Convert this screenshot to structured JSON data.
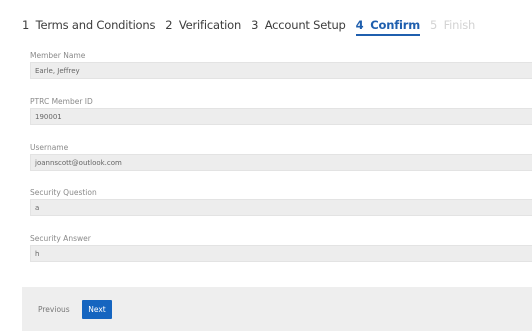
{
  "wizard": {
    "steps": [
      {
        "num": "1",
        "label": "Terms and Conditions",
        "state": "done"
      },
      {
        "num": "2",
        "label": "Verification",
        "state": "done"
      },
      {
        "num": "3",
        "label": "Account Setup",
        "state": "done"
      },
      {
        "num": "4",
        "label": "Confirm",
        "state": "active"
      },
      {
        "num": "5",
        "label": "Finish",
        "state": "disabled"
      }
    ]
  },
  "form": {
    "member_name": {
      "label": "Member Name",
      "value": "Earle, Jeffrey"
    },
    "member_id": {
      "label": "PTRC Member ID",
      "value": "190001"
    },
    "username": {
      "label": "Username",
      "value": "joannscott@outlook.com"
    },
    "security_question": {
      "label": "Security Question",
      "value": "a"
    },
    "security_answer": {
      "label": "Security Answer",
      "value": "h"
    }
  },
  "footer": {
    "previous_label": "Previous",
    "next_label": "Next"
  },
  "colors": {
    "accent": "#1565c0",
    "active_step": "#1f5fae",
    "field_bg": "#ededed",
    "footer_bg": "#eeeeee"
  }
}
